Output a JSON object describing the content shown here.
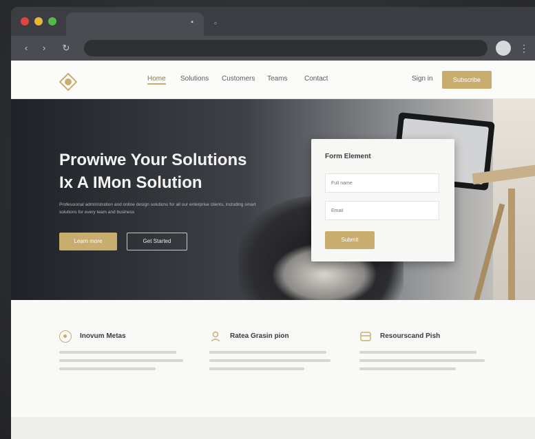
{
  "browser": {
    "tab_close_glyph": "▪",
    "new_tab_glyph": "◦",
    "back_glyph": "‹",
    "forward_glyph": "›",
    "reload_glyph": "↻",
    "menu_glyph": "⋮",
    "colors": {
      "close": "#e0443e",
      "minimize": "#e8b43a",
      "maximize": "#55b948"
    }
  },
  "site": {
    "nav": [
      {
        "label": "Home",
        "active": true
      },
      {
        "label": "Solutions"
      },
      {
        "label": "Customers"
      },
      {
        "label": "Teams"
      },
      {
        "label": "Contact"
      }
    ],
    "login_label": "Sign in",
    "cta_label": "Subscribe",
    "accent": "#c9ad6e",
    "hero": {
      "title_line1": "Prowiwe Your Solutions",
      "title_line2": "Ix A IMon Solution",
      "subtitle": "Professional administration and online design solutions for all our enterprise clients, including smart solutions for every team and business",
      "primary_button": "Learn more",
      "secondary_button": "Get Started"
    },
    "form": {
      "title": "Form Element",
      "name_placeholder": "Full name",
      "email_placeholder": "Email",
      "submit_label": "Submit"
    },
    "features": [
      {
        "title": "Inovum Metas",
        "icon": "circle-icon"
      },
      {
        "title": "Ratea Grasin pion",
        "icon": "person-icon"
      },
      {
        "title": "Resourscand Pish",
        "icon": "box-icon"
      }
    ]
  }
}
